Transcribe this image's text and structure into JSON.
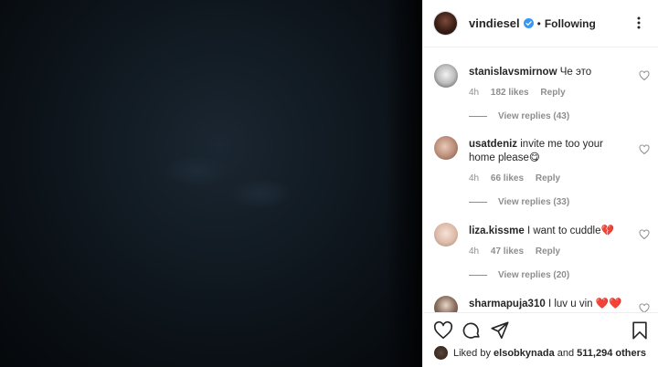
{
  "post": {
    "username": "vindiesel",
    "follow_status": "Following",
    "separator": "•"
  },
  "comments": [
    {
      "user": "stanislavsmirnow",
      "text": "Че это",
      "time": "4h",
      "likes": "182 likes",
      "reply": "Reply",
      "replies": "View replies (43)"
    },
    {
      "user": "usatdeniz",
      "text": "invite me too your home please😋",
      "time": "4h",
      "likes": "66 likes",
      "reply": "Reply",
      "replies": "View replies (33)"
    },
    {
      "user": "liza.kissme",
      "text": "I want to cuddle💔",
      "time": "4h",
      "likes": "47 likes",
      "reply": "Reply",
      "replies": "View replies (20)"
    },
    {
      "user": "sharmapuja310",
      "text": "I luv u vin ❤️❤️",
      "time": "",
      "likes": "",
      "reply": "",
      "replies": ""
    }
  ],
  "likes_bar": {
    "prefix": "Liked by",
    "user": "elsobkynada",
    "mid": "and",
    "count": "511,294 others"
  },
  "icons": [
    "verified-badge-icon",
    "more-options-icon",
    "heart-icon",
    "comment-icon",
    "share-icon",
    "bookmark-icon"
  ],
  "colors": {
    "verified": "#3897f0",
    "text": "#262626",
    "muted": "#8e8e8e",
    "heart_red": "#ed4956"
  }
}
